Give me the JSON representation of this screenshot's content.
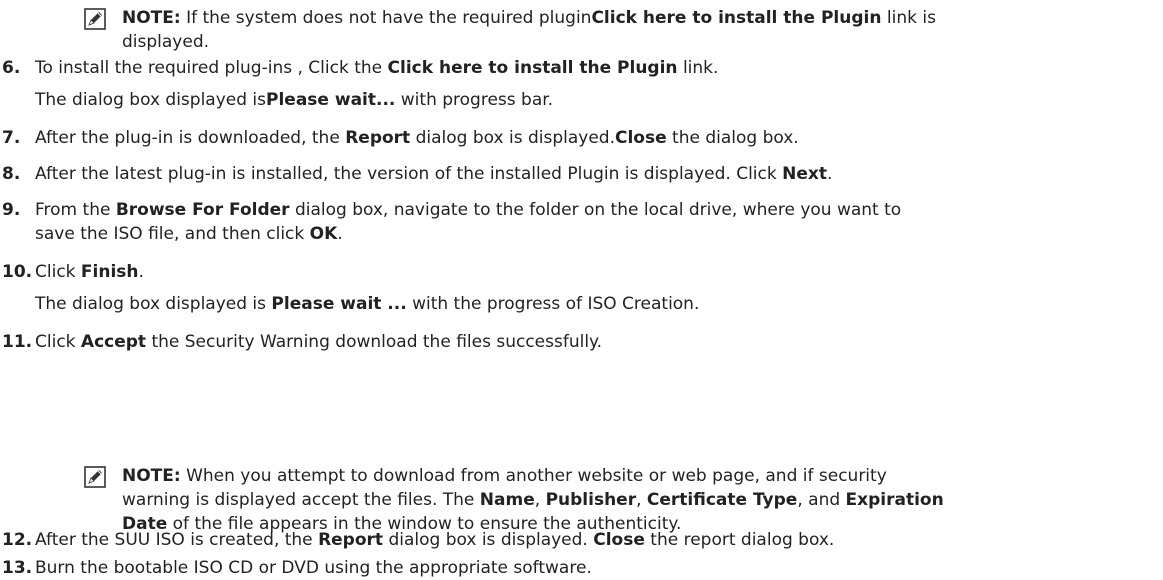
{
  "note1": {
    "icon": "note-pencil-icon",
    "label": "NOTE:",
    "text_a": " If the system does not have the required plugin",
    "link": "Click here to install the Plugin",
    "text_b": " link is",
    "line2": "displayed."
  },
  "steps": [
    {
      "num": "6.",
      "parts": [
        {
          "t": "To install the required plug-ins , Click the "
        },
        {
          "b": "Click here to install the Plugin"
        },
        {
          "t": " link."
        }
      ],
      "sub": [
        {
          "t": "The dialog box displayed is"
        },
        {
          "b": "Please wait..."
        },
        {
          "t": " with progress bar."
        }
      ]
    },
    {
      "num": "7.",
      "parts": [
        {
          "t": "After the plug-in is downloaded, the "
        },
        {
          "b": "Report"
        },
        {
          "t": " dialog box is displayed."
        },
        {
          "b": "Close"
        },
        {
          "t": " the dialog box."
        }
      ]
    },
    {
      "num": "8.",
      "parts": [
        {
          "t": "After the latest plug-in is installed, the version of the installed Plugin is displayed. Click "
        },
        {
          "b": "Next"
        },
        {
          "t": "."
        }
      ]
    },
    {
      "num": "9.",
      "parts": [
        {
          "t": "From the "
        },
        {
          "b": "Browse For Folder"
        },
        {
          "t": " dialog box, navigate to the folder on the local drive, where you want to"
        }
      ],
      "line2": [
        {
          "t": "save the ISO file, and then click "
        },
        {
          "b": "OK"
        },
        {
          "t": "."
        }
      ]
    },
    {
      "num": "10.",
      "parts": [
        {
          "t": "Click "
        },
        {
          "b": "Finish"
        },
        {
          "t": "."
        }
      ],
      "sub": [
        {
          "t": "The dialog box displayed is "
        },
        {
          "b": "Please wait ..."
        },
        {
          "t": " with the progress of ISO Creation."
        }
      ]
    },
    {
      "num": "11.",
      "parts": [
        {
          "t": "Click "
        },
        {
          "b": "Accept"
        },
        {
          "t": " the Security Warning download the files successfully."
        }
      ]
    },
    {
      "num": "12.",
      "parts": [
        {
          "t": "After the SUU ISO is created, the "
        },
        {
          "b": "Report"
        },
        {
          "t": " dialog box is displayed. "
        },
        {
          "b": "Close"
        },
        {
          "t": " the report dialog box."
        }
      ]
    },
    {
      "num": "13.",
      "parts": [
        {
          "t": "Burn the bootable ISO CD or DVD using the appropriate software."
        }
      ]
    }
  ],
  "note2": {
    "icon": "note-pencil-icon",
    "label": "NOTE:",
    "line1": " When you attempt to download from another website or web page, and if security",
    "line2_parts": [
      {
        "t": "warning is displayed accept the files. The "
      },
      {
        "b": "Name"
      },
      {
        "t": ", "
      },
      {
        "b": "Publisher"
      },
      {
        "t": ", "
      },
      {
        "b": "Certificate Type"
      },
      {
        "t": ", and "
      },
      {
        "b": "Expiration"
      }
    ],
    "line3_parts": [
      {
        "b": "Date"
      },
      {
        "t": " of the file appears in the window to ensure the authenticity."
      }
    ]
  }
}
